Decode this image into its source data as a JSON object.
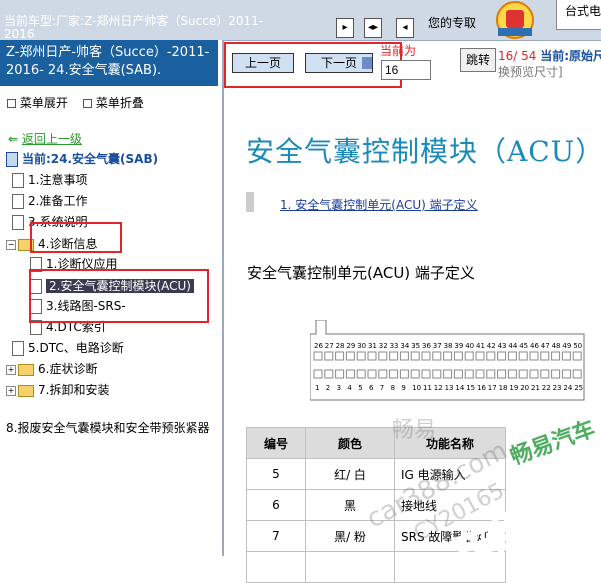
{
  "topbar": {
    "current_model_prefix": "当前车型:",
    "current_model": "厂家:Z-郑州日产帅客（Succe）2011-",
    "current_model_line2": "2016",
    "shortcut_text": "您的专取",
    "right_tab": "台式电",
    "nav_icons": [
      "forward-icon",
      "split-icon",
      "back-icon"
    ]
  },
  "left": {
    "header": "Z-郑州日产-帅客（Succe）-2011-2016- 24.安全气囊(SAB).",
    "menu_expand": "菜单展开",
    "menu_collapse": "菜单折叠",
    "back_link": "返回上一级",
    "current_label": "当前:24.安全气囊(SAB)",
    "tree": [
      {
        "label": "1.注意事项",
        "type": "page",
        "level": 1
      },
      {
        "label": "2.准备工作",
        "type": "page",
        "level": 1
      },
      {
        "label": "3.系统说明",
        "type": "page",
        "level": 1
      },
      {
        "label": "4.诊断信息",
        "type": "folder",
        "level": 1,
        "expanded": true
      },
      {
        "label": "1.诊断仪应用",
        "type": "page",
        "level": 2
      },
      {
        "label": "2.安全气囊控制模块(ACU)",
        "type": "page",
        "level": 2,
        "selected": true
      },
      {
        "label": "3.线路图-SRS-",
        "type": "page",
        "level": 2
      },
      {
        "label": "4.DTC索引",
        "type": "page",
        "level": 2
      },
      {
        "label": "5.DTC、电路诊断",
        "type": "page",
        "level": 1
      },
      {
        "label": "6.症状诊断",
        "type": "folder",
        "level": 1
      },
      {
        "label": "7.拆卸和安装",
        "type": "folder",
        "level": 1
      },
      {
        "label": "8.报废安全气囊模块和安全带预张紧器",
        "type": "page",
        "level": 0
      }
    ]
  },
  "toolbar": {
    "prev_label": "上一页",
    "next_label": "下一页",
    "current_label": "当前为",
    "page_value": "16",
    "jump_label": "跳转",
    "page_indicator": "16/ 54",
    "current_prefix": "当前:",
    "current_size": "原始尺",
    "switch_size": "换预览尺寸]"
  },
  "document": {
    "title": "安全气囊控制模块（ACU）",
    "toc_item": "1. 安全气囊控制单元(ACU) 端子定义",
    "section_title": "安全气囊控制单元(ACU) 端子定义",
    "connector_pins_top": [
      "26",
      "27",
      "28",
      "29",
      "30",
      "31",
      "32",
      "33",
      "34",
      "35",
      "36",
      "37",
      "38",
      "39",
      "40",
      "41",
      "42",
      "43",
      "44",
      "45",
      "46",
      "47",
      "48",
      "49",
      "50"
    ],
    "connector_pins_bottom": [
      "1",
      "2",
      "3",
      "4",
      "5",
      "6",
      "7",
      "8",
      "9",
      "10",
      "11",
      "12",
      "13",
      "14",
      "15",
      "16",
      "17",
      "18",
      "19",
      "20",
      "21",
      "22",
      "23",
      "24",
      "25"
    ],
    "table": {
      "headers": [
        "编号",
        "颜色",
        "功能名称"
      ],
      "rows": [
        [
          "5",
          "红/ 白",
          "IG 电源输入"
        ],
        [
          "6",
          "黑",
          "接地线"
        ],
        [
          "7",
          "黑/ 粉",
          "SRS 故障警告灯"
        ],
        [
          "",
          "",
          ""
        ]
      ]
    }
  },
  "watermarks": [
    "畅易",
    "car388.com",
    "CY20165",
    "畅易汽车",
    "车维修"
  ],
  "colors": {
    "title_blue": "#1a8ab9",
    "header_blue": "#1a5f9e",
    "highlight_red": "#e3242b",
    "watermark_green": "#2fa044"
  }
}
